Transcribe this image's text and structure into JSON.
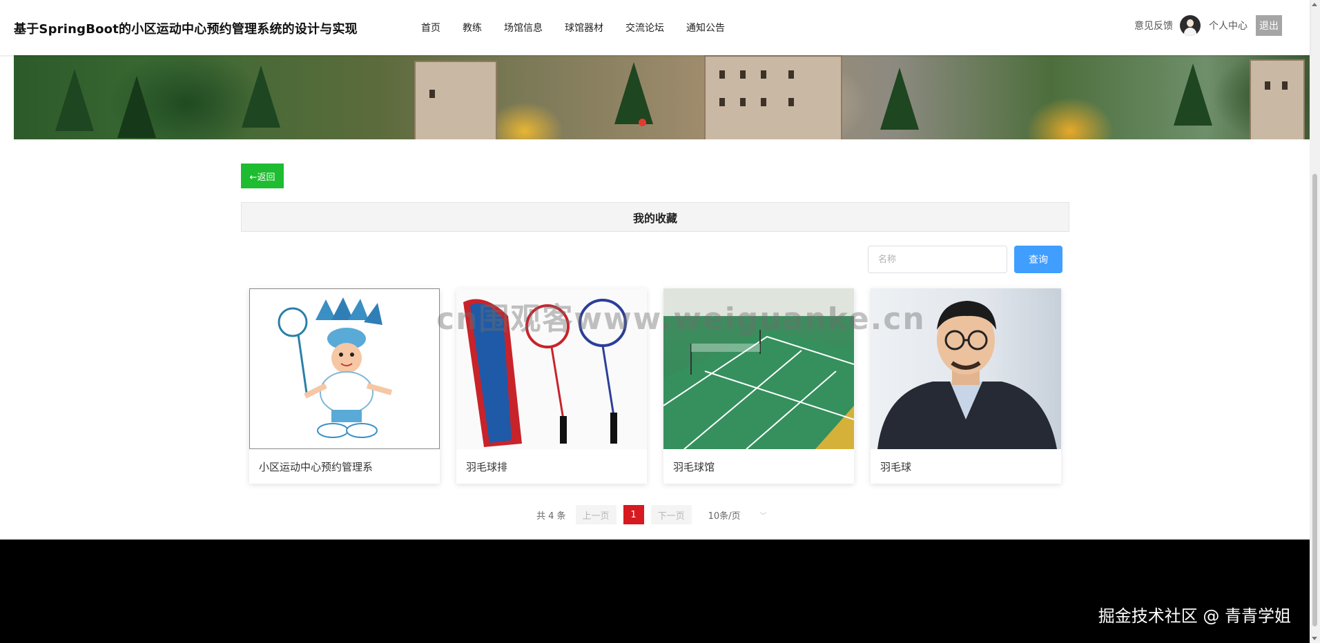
{
  "header": {
    "site_title": "基于SpringBoot的小区运动中心预约管理系统的设计与实现",
    "nav": [
      "首页",
      "教练",
      "场馆信息",
      "球馆器材",
      "交流论坛",
      "通知公告"
    ],
    "feedback_label": "意见反馈",
    "profile_label": "个人中心",
    "logout_label": "退出"
  },
  "main": {
    "back_label": "←返回",
    "section_title": "我的收藏",
    "search": {
      "placeholder": "名称",
      "value": ""
    },
    "search_button": "查询",
    "cards": [
      {
        "name": "小区运动中心预约管理系",
        "image": "badminton-mascot"
      },
      {
        "name": "羽毛球排",
        "image": "badminton-rackets"
      },
      {
        "name": "羽毛球馆",
        "image": "badminton-court"
      },
      {
        "name": "羽毛球",
        "image": "man-portrait"
      }
    ]
  },
  "pagination": {
    "total": "共 4 条",
    "prev": "上一页",
    "current_page": "1",
    "next": "下一页",
    "page_size": "10条/页"
  },
  "watermark": "cn围观客www.weiguanke.cn",
  "footer": {
    "credit": "掘金技术社区 @ 青青学姐"
  },
  "colors": {
    "back_button": "#1ebc30",
    "search_button": "#409eff",
    "active_page": "#d71920",
    "banner_dot": "#e33b2f",
    "footer_bg": "#000000"
  }
}
